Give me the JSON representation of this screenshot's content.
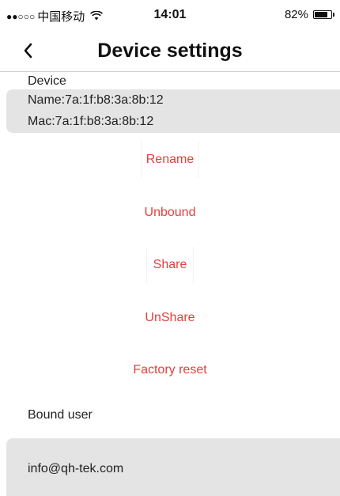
{
  "status_bar": {
    "signal": "●●○○○",
    "carrier": "中国移动",
    "wifi_icon": "wifi-icon",
    "time": "14:01",
    "battery_text": "82%",
    "battery_level": 0.82
  },
  "nav": {
    "back_icon": "chevron-left-icon",
    "title": "Device settings"
  },
  "device": {
    "label": "Device",
    "name": "Name:7a:1f:b8:3a:8b:12",
    "mac": "Mac:7a:1f:b8:3a:8b:12"
  },
  "actions": {
    "rename": "Rename",
    "unbound": "Unbound",
    "share": "Share",
    "unshare": "UnShare",
    "factory_reset": "Factory reset"
  },
  "bound_user": {
    "label": "Bound user",
    "email": "info@qh-tek.com"
  },
  "colors": {
    "action_text": "#e0403c",
    "box_background": "#e4e4e4"
  }
}
